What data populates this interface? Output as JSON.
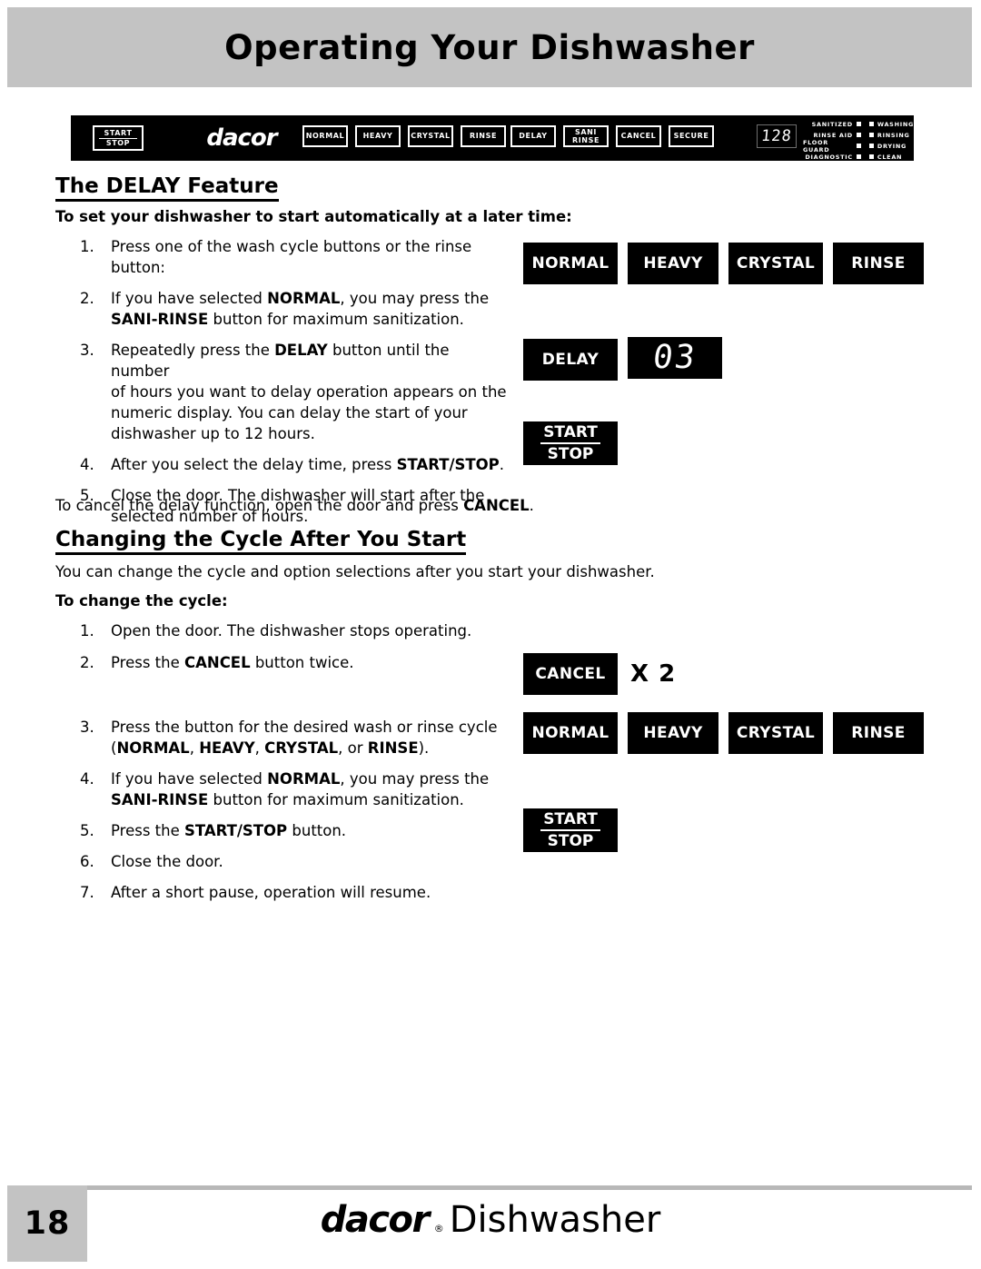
{
  "header": {
    "title": "Operating Your Dishwasher"
  },
  "control_panel": {
    "start_stop": {
      "top": "START",
      "bottom": "STOP"
    },
    "brand": "dacor",
    "cycle_buttons": [
      "NORMAL",
      "HEAVY",
      "CRYSTAL",
      "RINSE"
    ],
    "option_buttons": [
      {
        "line1": "DELAY",
        "line2": ""
      },
      {
        "line1": "SANI",
        "line2": "RINSE"
      },
      {
        "line1": "CANCEL",
        "line2": ""
      },
      {
        "line1": "SECURE",
        "line2": ""
      }
    ],
    "numeric_display": "128",
    "indicators_left": [
      "SANITIZED",
      "RINSE AID",
      "FLOOR GUARD",
      "DIAGNOSTIC"
    ],
    "indicators_right": [
      "WASHING",
      "RINSING",
      "DRYING",
      "CLEAN"
    ]
  },
  "section_delay": {
    "heading": "The DELAY Feature",
    "lead": "To set your dishwasher to start automatically at a later time:",
    "steps": [
      {
        "num": "1.",
        "lines": [
          [
            {
              "t": "Press one of the wash cycle buttons or the rinse",
              "b": false
            }
          ],
          [
            {
              "t": "button:",
              "b": false
            }
          ]
        ]
      },
      {
        "num": "2.",
        "lines": [
          [
            {
              "t": "If you have selected ",
              "b": false
            },
            {
              "t": "NORMAL",
              "b": true
            },
            {
              "t": ", you may press the",
              "b": false
            }
          ],
          [
            {
              "t": "SANI-RINSE",
              "b": true
            },
            {
              "t": " button for maximum sanitization.",
              "b": false
            }
          ]
        ]
      },
      {
        "num": "3.",
        "lines": [
          [
            {
              "t": "Repeatedly press the ",
              "b": false
            },
            {
              "t": "DELAY",
              "b": true
            },
            {
              "t": " button until the number",
              "b": false
            }
          ],
          [
            {
              "t": "of hours you want to delay operation appears on the",
              "b": false
            }
          ],
          [
            {
              "t": "numeric display. You can delay the start of your",
              "b": false
            }
          ],
          [
            {
              "t": "dishwasher up to 12 hours.",
              "b": false
            }
          ]
        ]
      },
      {
        "num": "4.",
        "lines": [
          [
            {
              "t": "After you select the delay time, press ",
              "b": false
            },
            {
              "t": "START/STOP",
              "b": true
            },
            {
              "t": ".",
              "b": false
            }
          ]
        ]
      },
      {
        "num": "5.",
        "lines": [
          [
            {
              "t": "Close the door. The dishwasher will start after the",
              "b": false
            }
          ],
          [
            {
              "t": "selected number of hours.",
              "b": false
            }
          ]
        ]
      }
    ],
    "closing": [
      {
        "t": "To cancel the delay function, open the door and press ",
        "b": false
      },
      {
        "t": "CANCEL",
        "b": true
      },
      {
        "t": ".",
        "b": false
      }
    ],
    "illustration": {
      "cycle_buttons": [
        "NORMAL",
        "HEAVY",
        "CRYSTAL",
        "RINSE"
      ],
      "delay_button": "DELAY",
      "delay_display": "03",
      "start_stop": {
        "top": "START",
        "bottom": "STOP"
      }
    }
  },
  "section_change": {
    "heading": "Changing the Cycle After You Start",
    "intro": "You can change the cycle and option selections after you start your dishwasher.",
    "lead": "To change the cycle:",
    "steps": [
      {
        "num": "1.",
        "lines": [
          [
            {
              "t": "Open the door. The dishwasher stops operating.",
              "b": false
            }
          ]
        ]
      },
      {
        "num": "2.",
        "lines": [
          [
            {
              "t": "Press the ",
              "b": false
            },
            {
              "t": "CANCEL",
              "b": true
            },
            {
              "t": " button twice.",
              "b": false
            }
          ]
        ]
      },
      {
        "num": "3.",
        "lines": [
          [
            {
              "t": "Press the button for the desired wash or rinse cycle",
              "b": false
            }
          ],
          [
            {
              "t": "(",
              "b": false
            },
            {
              "t": "NORMAL",
              "b": true
            },
            {
              "t": ", ",
              "b": false
            },
            {
              "t": "HEAVY",
              "b": true
            },
            {
              "t": ", ",
              "b": false
            },
            {
              "t": "CRYSTAL",
              "b": true
            },
            {
              "t": ", or ",
              "b": false
            },
            {
              "t": "RINSE",
              "b": true
            },
            {
              "t": ").",
              "b": false
            }
          ]
        ]
      },
      {
        "num": "4.",
        "lines": [
          [
            {
              "t": "If you have selected ",
              "b": false
            },
            {
              "t": "NORMAL",
              "b": true
            },
            {
              "t": ", you may press the",
              "b": false
            }
          ],
          [
            {
              "t": "SANI-RINSE",
              "b": true
            },
            {
              "t": " button for maximum sanitization.",
              "b": false
            }
          ]
        ]
      },
      {
        "num": "5.",
        "lines": [
          [
            {
              "t": "Press the ",
              "b": false
            },
            {
              "t": "START/STOP",
              "b": true
            },
            {
              "t": " button.",
              "b": false
            }
          ]
        ]
      },
      {
        "num": "6.",
        "lines": [
          [
            {
              "t": "Close the door.",
              "b": false
            }
          ]
        ]
      },
      {
        "num": "7.",
        "lines": [
          [
            {
              "t": "After a short pause, operation will resume.",
              "b": false
            }
          ]
        ]
      }
    ],
    "illustration": {
      "cancel_button": "CANCEL",
      "multiplier": "X 2",
      "cycle_buttons": [
        "NORMAL",
        "HEAVY",
        "CRYSTAL",
        "RINSE"
      ],
      "start_stop": {
        "top": "START",
        "bottom": "STOP"
      }
    }
  },
  "footer": {
    "page_number": "18",
    "brand": "dacor",
    "brand_mark": "®",
    "product": "Dishwasher"
  }
}
